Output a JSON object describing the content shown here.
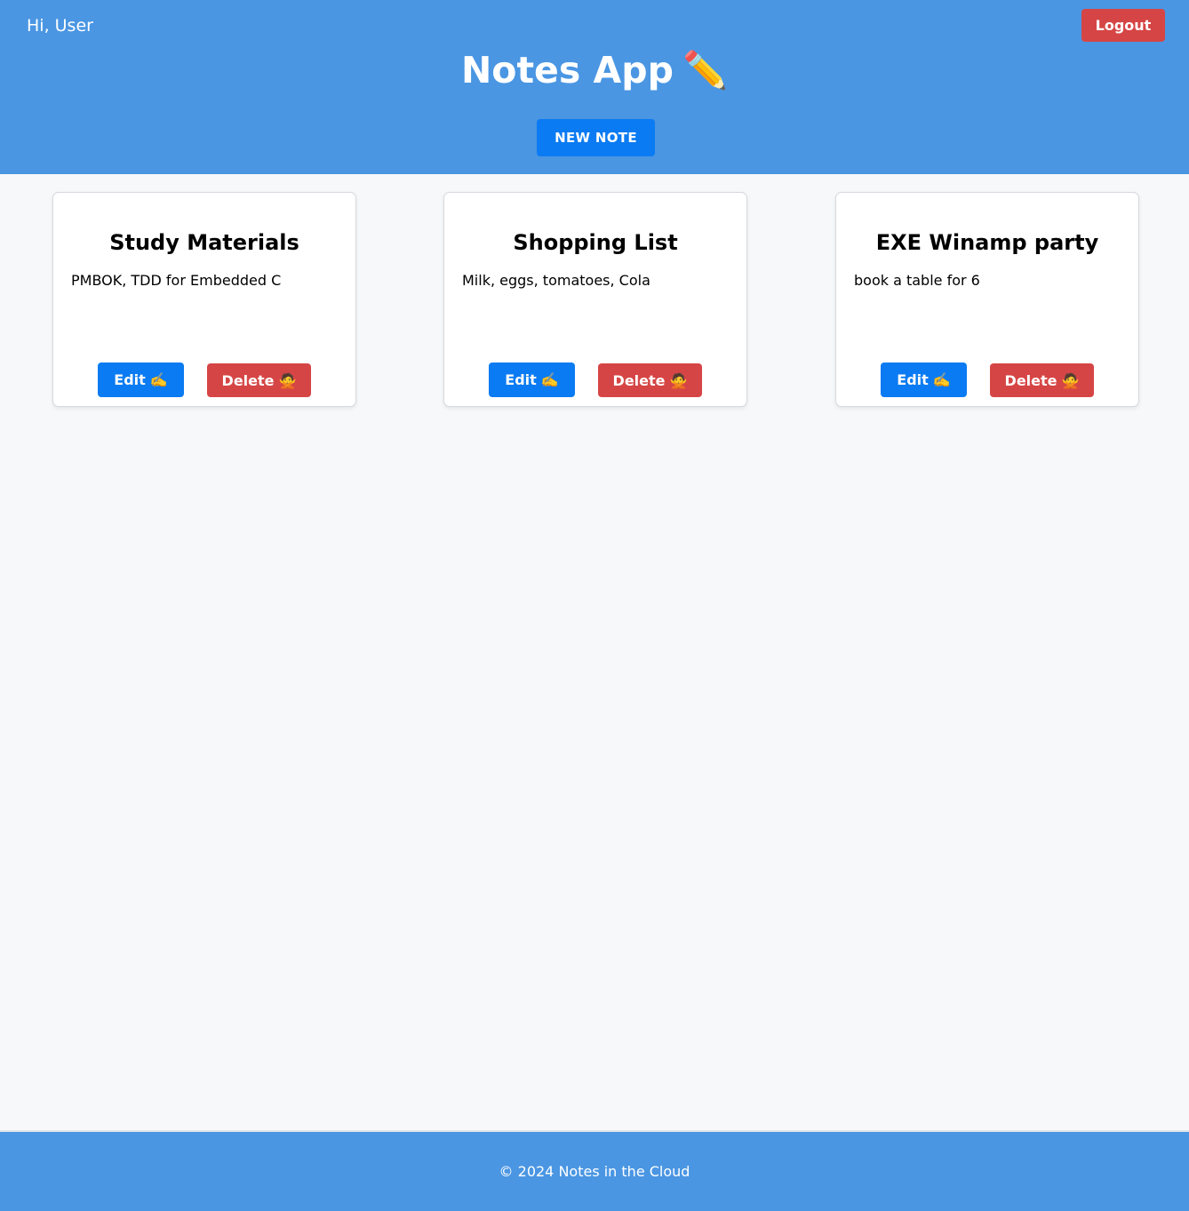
{
  "header": {
    "greeting": "Hi, User",
    "logout_label": "Logout",
    "title": "Notes App",
    "title_emoji": "✏️",
    "new_note_label": "NEW NOTE"
  },
  "notes": [
    {
      "title": "Study Materials",
      "body": "PMBOK, TDD for Embedded C",
      "edit_label": "Edit",
      "edit_emoji": "✍️",
      "delete_label": "Delete",
      "delete_emoji": "🙅"
    },
    {
      "title": "Shopping List",
      "body": "Milk, eggs, tomatoes, Cola",
      "edit_label": "Edit",
      "edit_emoji": "✍️",
      "delete_label": "Delete",
      "delete_emoji": "🙅"
    },
    {
      "title": "EXE Winamp party",
      "body": "book a table for 6",
      "edit_label": "Edit",
      "edit_emoji": "✍️",
      "delete_label": "Delete",
      "delete_emoji": "🙅"
    }
  ],
  "footer": {
    "text": "© 2024 Notes in the Cloud"
  },
  "colors": {
    "header_bg": "#4a96e3",
    "primary_button": "#0a7bf2",
    "danger_button": "#d64545",
    "page_bg": "#f7f8fa"
  },
  "icons": {
    "title_icon": "pencil-icon",
    "edit_icon": "writing-hand-icon",
    "delete_icon": "no-gesture-icon"
  }
}
